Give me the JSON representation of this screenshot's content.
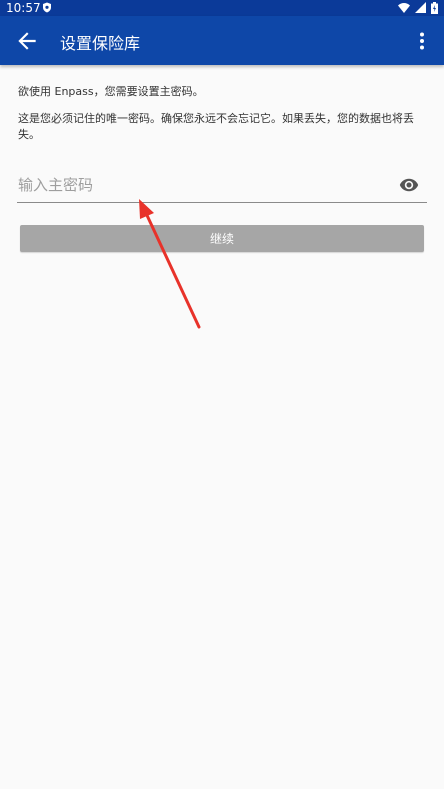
{
  "status_bar": {
    "time": "10:57"
  },
  "app_bar": {
    "title": "设置保险库"
  },
  "content": {
    "intro_text": "欲使用 Enpass，您需要设置主密码。",
    "warning_text": "这是您必须记住的唯一密码。确保您永远不会忘记它。如果丢失，您的数据也将丢失。",
    "password_input": {
      "placeholder": "输入主密码",
      "value": ""
    },
    "continue_label": "继续"
  },
  "colors": {
    "status_bar": "#0b3a99",
    "app_bar": "#0e47a8",
    "button_disabled": "#a6a6a6",
    "annotation_arrow": "#e8322a"
  }
}
